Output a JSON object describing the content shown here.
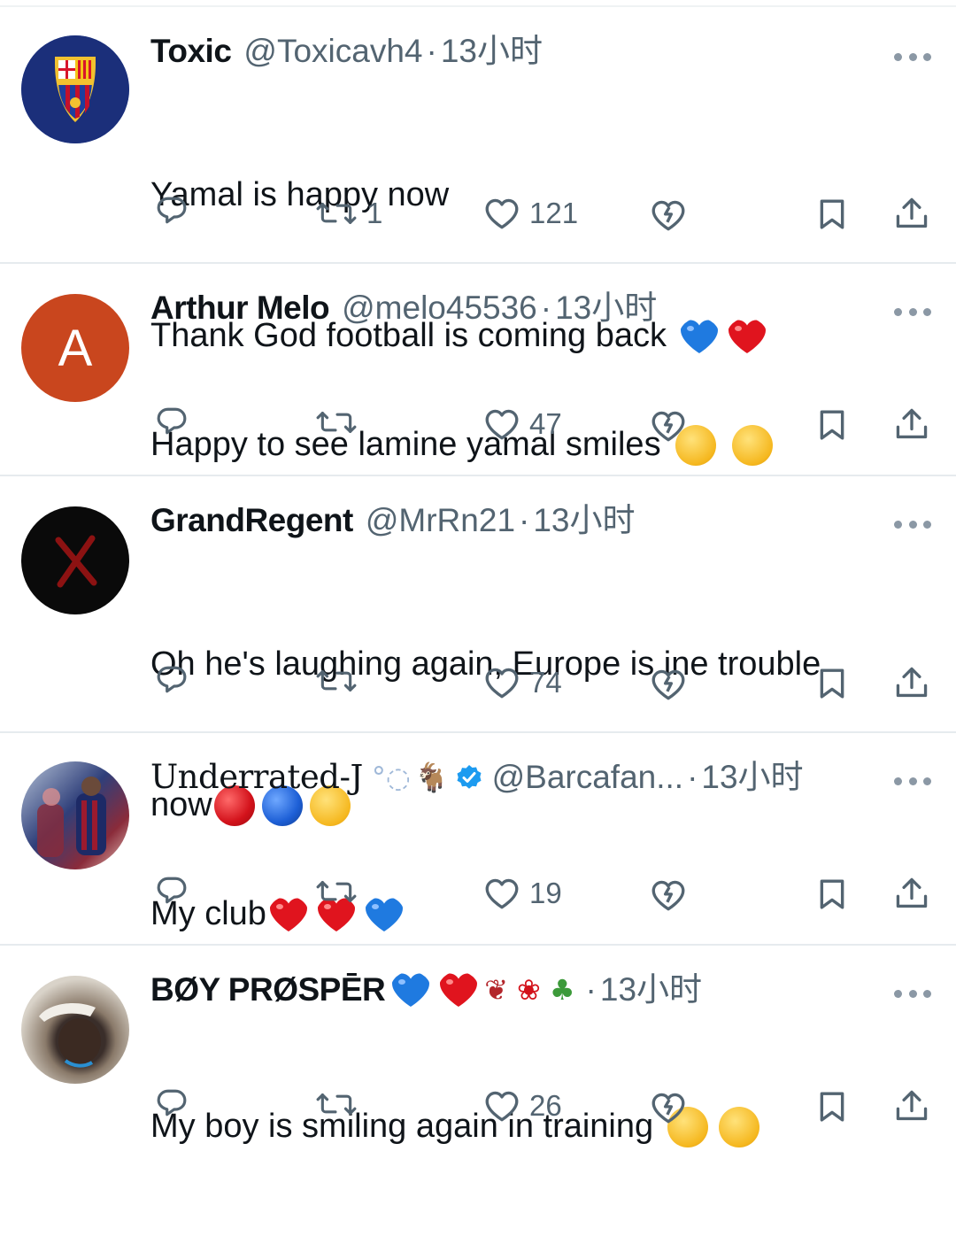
{
  "tweets": [
    {
      "name": "Toxic",
      "handle": "@Toxicavh4",
      "separator": "·",
      "time": "13小时",
      "text_lines": [
        "Yamal is happy now",
        "Thank God football is coming back"
      ],
      "retweets": "1",
      "likes": "121",
      "avatar_icon": "fc-barcelona-crest-icon"
    },
    {
      "name": "Arthur Melo",
      "handle": "@melo45536",
      "separator": "·",
      "time": "13小时",
      "avatar_letter": "A",
      "text_lines": [
        "Happy to see lamine yamal smiles"
      ],
      "retweets": "",
      "likes": "47"
    },
    {
      "name": "GrandRegent",
      "handle": "@MrRn21",
      "separator": "·",
      "time": "13小时",
      "text_lines": [
        "Oh he's laughing again, Europe is ine trouble",
        "now"
      ],
      "retweets": "",
      "likes": "74"
    },
    {
      "name": "Underrated-J",
      "handle": "@Barcafan...",
      "separator": "·",
      "time": "13小时",
      "text_lines": [
        "My club"
      ],
      "retweets": "",
      "likes": "19"
    },
    {
      "name": "BØY PRØSPĒR",
      "handle": "",
      "separator": "·",
      "time": "13小时",
      "text_lines": [
        "My boy is smiling again in training"
      ],
      "retweets": "",
      "likes": "26"
    }
  ],
  "colors": {
    "text": "#0f1419",
    "muted": "#536471",
    "divider": "#e6ebee",
    "verified": "#1d9bf0",
    "heart_red": "#e0141e",
    "heart_blue": "#1f7ae0"
  }
}
